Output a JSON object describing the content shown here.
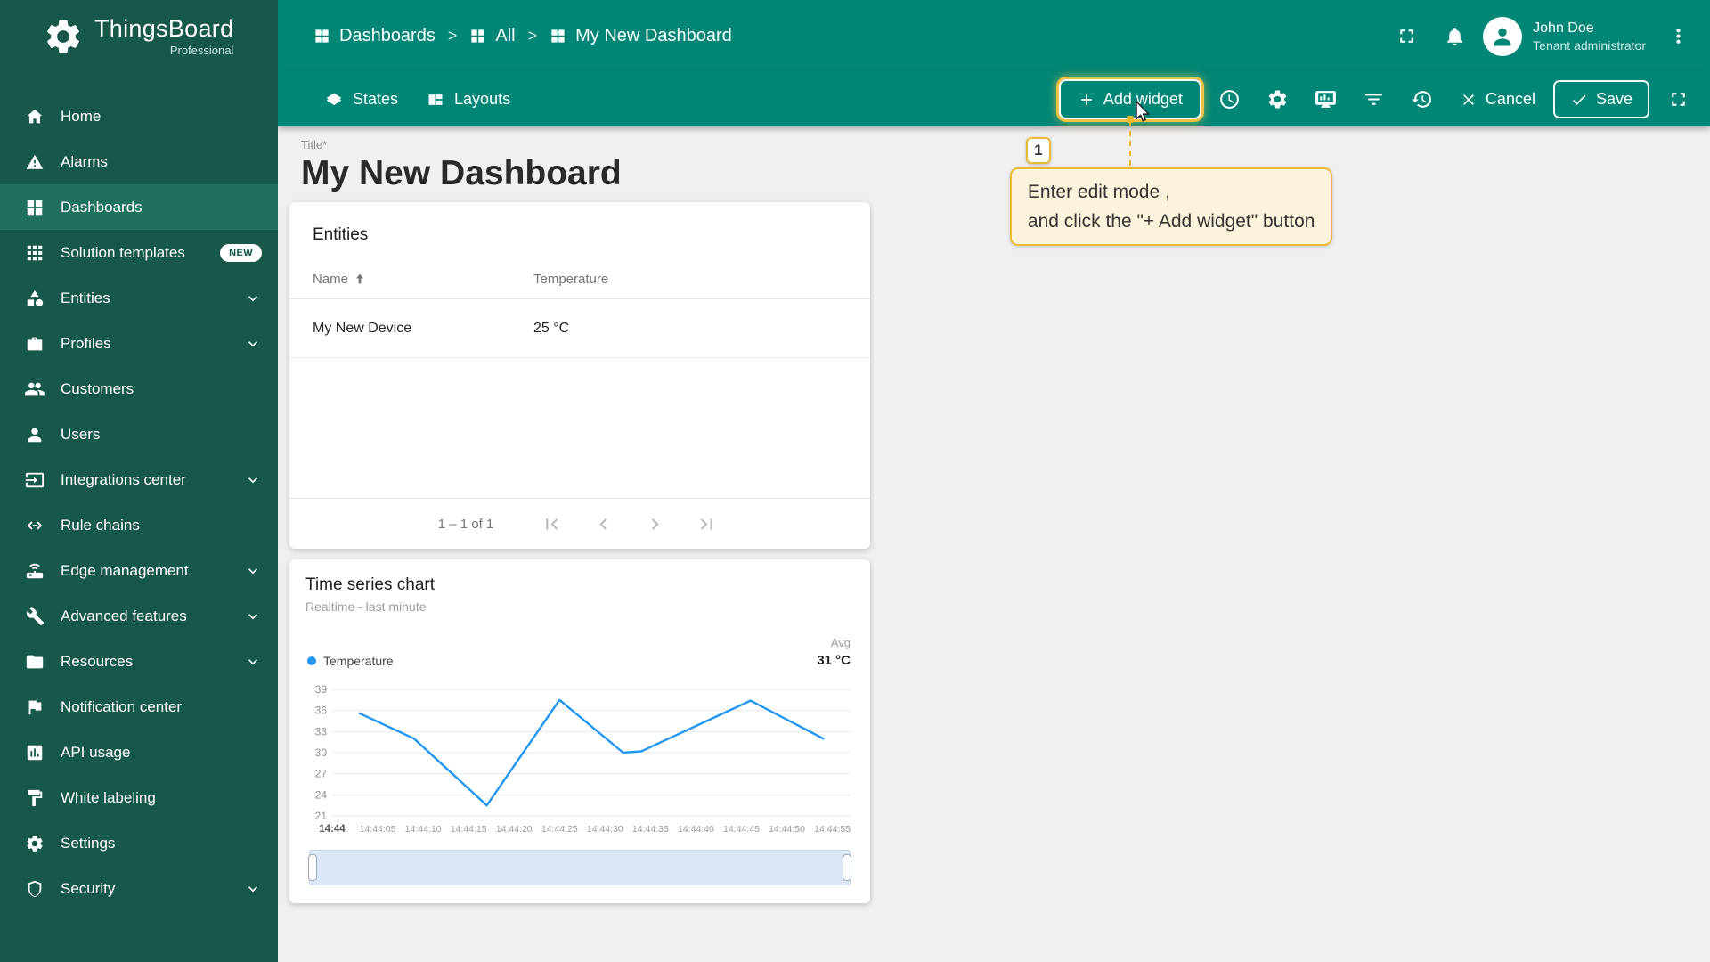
{
  "app": {
    "name": "ThingsBoard",
    "edition": "Professional"
  },
  "header": {
    "breadcrumbs": [
      {
        "label": "Dashboards"
      },
      {
        "label": "All"
      },
      {
        "label": "My New Dashboard"
      }
    ],
    "separator": ">",
    "user": {
      "name": "John Doe",
      "role": "Tenant administrator"
    }
  },
  "toolbar": {
    "states_label": "States",
    "layouts_label": "Layouts",
    "add_widget_label": "Add widget",
    "cancel_label": "Cancel",
    "save_label": "Save"
  },
  "sidebar": {
    "items": [
      {
        "label": "Home",
        "icon": "home"
      },
      {
        "label": "Alarms",
        "icon": "warning"
      },
      {
        "label": "Dashboards",
        "icon": "dashboards",
        "selected": true
      },
      {
        "label": "Solution templates",
        "icon": "apps",
        "badge": "NEW"
      },
      {
        "label": "Entities",
        "icon": "entities",
        "expandable": true
      },
      {
        "label": "Profiles",
        "icon": "briefcase",
        "expandable": true
      },
      {
        "label": "Customers",
        "icon": "people"
      },
      {
        "label": "Users",
        "icon": "person"
      },
      {
        "label": "Integrations center",
        "icon": "input",
        "expandable": true
      },
      {
        "label": "Rule chains",
        "icon": "rulechain"
      },
      {
        "label": "Edge management",
        "icon": "edge",
        "expandable": true
      },
      {
        "label": "Advanced features",
        "icon": "tools",
        "expandable": true
      },
      {
        "label": "Resources",
        "icon": "folder",
        "expandable": true
      },
      {
        "label": "Notification center",
        "icon": "flag"
      },
      {
        "label": "API usage",
        "icon": "chart-box"
      },
      {
        "label": "White labeling",
        "icon": "paint"
      },
      {
        "label": "Settings",
        "icon": "gear"
      },
      {
        "label": "Security",
        "icon": "shield",
        "expandable": true
      }
    ]
  },
  "main": {
    "title_label": "Title*",
    "dashboard_title": "My New Dashboard",
    "entities_card": {
      "title": "Entities",
      "columns": [
        "Name",
        "Temperature"
      ],
      "rows": [
        [
          "My New Device",
          "25 °C"
        ]
      ],
      "pagination": "1 – 1 of 1"
    },
    "annotation": {
      "step": "1",
      "line1": "Enter edit mode ,",
      "line2": "and click the \"+ Add widget\" button"
    }
  },
  "chart_data": {
    "type": "line",
    "title": "Time series chart",
    "subtitle": "Realtime - last minute",
    "aggregation_label": "Avg",
    "series": [
      {
        "name": "Temperature",
        "color": "#2196f3",
        "agg_value": "31 °C",
        "points_time_seconds": [
          3,
          9,
          17,
          25,
          32,
          34,
          46,
          54
        ],
        "values": [
          35.6,
          32,
          22.5,
          37.5,
          30,
          30.2,
          37.4,
          32
        ]
      }
    ],
    "ylim": [
      21,
      39
    ],
    "yticks": [
      39,
      36,
      33,
      30,
      27,
      24,
      21
    ],
    "x_domain_seconds": [
      0,
      57
    ],
    "xtick_seconds": [
      0,
      5,
      10,
      15,
      20,
      25,
      30,
      35,
      40,
      45,
      50,
      55
    ],
    "xtick_labels": [
      "14:44",
      "14:44:05",
      "14:44:10",
      "14:44:15",
      "14:44:20",
      "14:44:25",
      "14:44:30",
      "14:44:35",
      "14:44:40",
      "14:44:45",
      "14:44:50",
      "14:44:55"
    ],
    "grid": true,
    "legend_position": "top"
  },
  "colors": {
    "sidebar_bg": "#17584b",
    "sidebar_selected": "#20705e",
    "header_bg": "#008676",
    "accent_yellow": "#e8bb31",
    "annotation_bg": "#fdf3dc",
    "chart_line": "#2196f3"
  }
}
